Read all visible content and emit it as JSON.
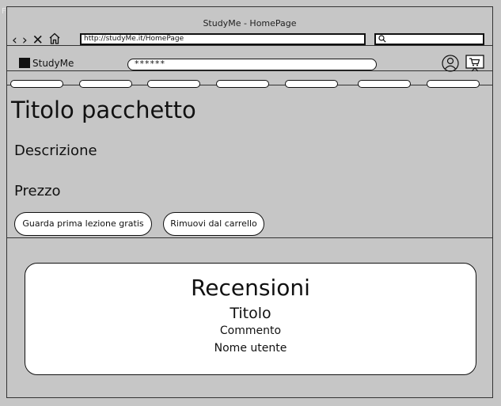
{
  "frame_label": "Frame",
  "window": {
    "title": "StudyMe - HomePage",
    "url": "http://studyMe.it/HomePage",
    "search_value": ""
  },
  "nav_icons": [
    "back-icon",
    "forward-icon",
    "close-icon",
    "home-icon",
    "search-icon"
  ],
  "header": {
    "logo_text": "StudyMe",
    "search_value": "******",
    "icons": [
      "user-icon",
      "cart-icon"
    ]
  },
  "menu": {
    "item_count": 7
  },
  "package": {
    "title": "Titolo pacchetto",
    "description": "Descrizione",
    "price": "Prezzo",
    "free_lesson_button": "Guarda prima lezione gratis",
    "remove_cart_button": "Rimuovi dal carrello"
  },
  "reviews": {
    "heading": "Recensioni",
    "title": "Titolo",
    "comment": "Commento",
    "username": "Nome utente"
  }
}
